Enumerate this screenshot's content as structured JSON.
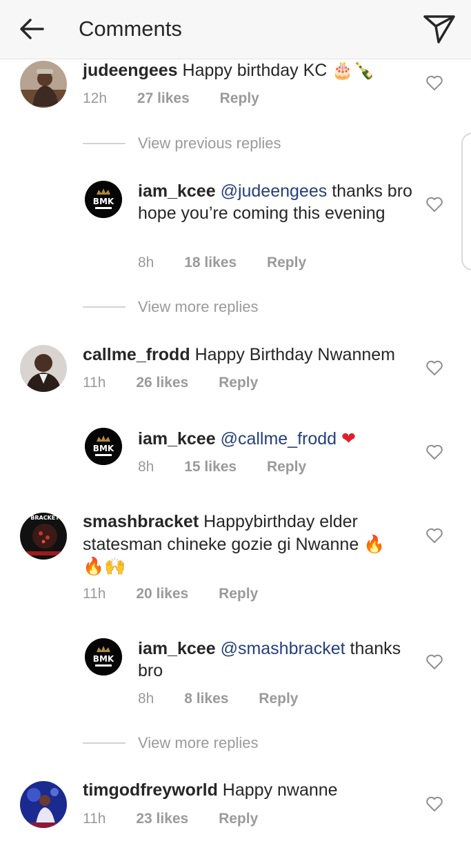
{
  "header": {
    "title": "Comments",
    "back_icon": "arrow-left-icon",
    "send_icon": "paper-plane-icon"
  },
  "comments": [
    {
      "username": "judeengees",
      "text": "Happy birthday KC",
      "emoji": "🎂🍾",
      "time": "12h",
      "likes": "27 likes",
      "reply": "Reply",
      "view_replies": "View previous replies"
    },
    {
      "username": "iam_kcee",
      "mention": "@judeengees",
      "text": "thanks bro hope you’re coming this evening",
      "time": "8h",
      "likes": "18 likes",
      "reply": "Reply",
      "view_replies": "View more replies"
    },
    {
      "username": "callme_frodd",
      "text": "Happy Birthday Nwannem",
      "time": "11h",
      "likes": "26 likes",
      "reply": "Reply"
    },
    {
      "username": "iam_kcee",
      "mention": "@callme_frodd",
      "emoji": "❤",
      "time": "8h",
      "likes": "15 likes",
      "reply": "Reply"
    },
    {
      "username": "smashbracket",
      "text": "Happybirthday elder statesman chineke gozie gi Nwanne",
      "emoji1": "🔥",
      "emoji2": "🔥🙌",
      "time": "11h",
      "likes": "20 likes",
      "reply": "Reply"
    },
    {
      "username": "iam_kcee",
      "mention": "@smashbracket",
      "text": "thanks bro",
      "time": "8h",
      "likes": "8 likes",
      "reply": "Reply",
      "view_replies": "View more replies"
    },
    {
      "username": "timgodfreyworld",
      "text": "Happy nwanne",
      "time": "11h",
      "likes": "23 likes",
      "reply": "Reply"
    }
  ],
  "avatar_labels": {
    "bmk": "BMK",
    "bracket": "BRACKET"
  },
  "colors": {
    "mention": "#233f7d",
    "meta": "#9a9a9a",
    "heart_red": "#e0202a",
    "header_bg": "#f7f7f7"
  }
}
